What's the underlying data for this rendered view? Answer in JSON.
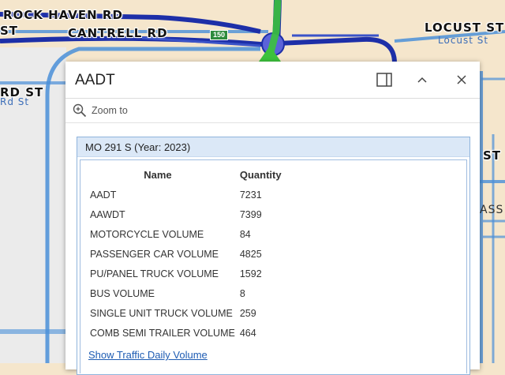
{
  "map": {
    "road_labels": {
      "rock_haven": "ROCK HAVEN RD",
      "cantrell": "CANTRELL RD",
      "st_top_left": "ST",
      "rd_st": "RD ST",
      "rd_st_faint": "Rd St",
      "locust": "LOCUST ST",
      "locust_faint": "Locust St",
      "st_right": "ST",
      "ass_right": "ASS",
      "route_shield": "150"
    },
    "colors": {
      "land": "#f5e6cc",
      "highway": "#1d2fa8",
      "local_road": "#4a8fd8",
      "selected_segment": "#3cc23c"
    }
  },
  "popup": {
    "title": "AADT",
    "dock_icon": "dock-icon",
    "collapse_icon": "chevron-up-icon",
    "close_icon": "close-icon",
    "zoom_to": {
      "icon": "zoom-in-icon",
      "label": "Zoom to"
    },
    "feature": {
      "title": "MO 291 S (Year: 2023)",
      "table": {
        "headers": {
          "name": "Name",
          "quantity": "Quantity"
        },
        "rows": [
          {
            "name": "AADT",
            "quantity": "7231"
          },
          {
            "name": "AAWDT",
            "quantity": "7399"
          },
          {
            "name": "MOTORCYCLE VOLUME",
            "quantity": "84"
          },
          {
            "name": "PASSENGER CAR VOLUME",
            "quantity": "4825"
          },
          {
            "name": "PU/PANEL TRUCK VOLUME",
            "quantity": "1592"
          },
          {
            "name": "BUS VOLUME",
            "quantity": "8"
          },
          {
            "name": "SINGLE UNIT TRUCK VOLUME",
            "quantity": "259"
          },
          {
            "name": "COMB SEMI TRAILER VOLUME",
            "quantity": "464"
          }
        ]
      },
      "link_label": "Show Traffic Daily Volume"
    }
  }
}
